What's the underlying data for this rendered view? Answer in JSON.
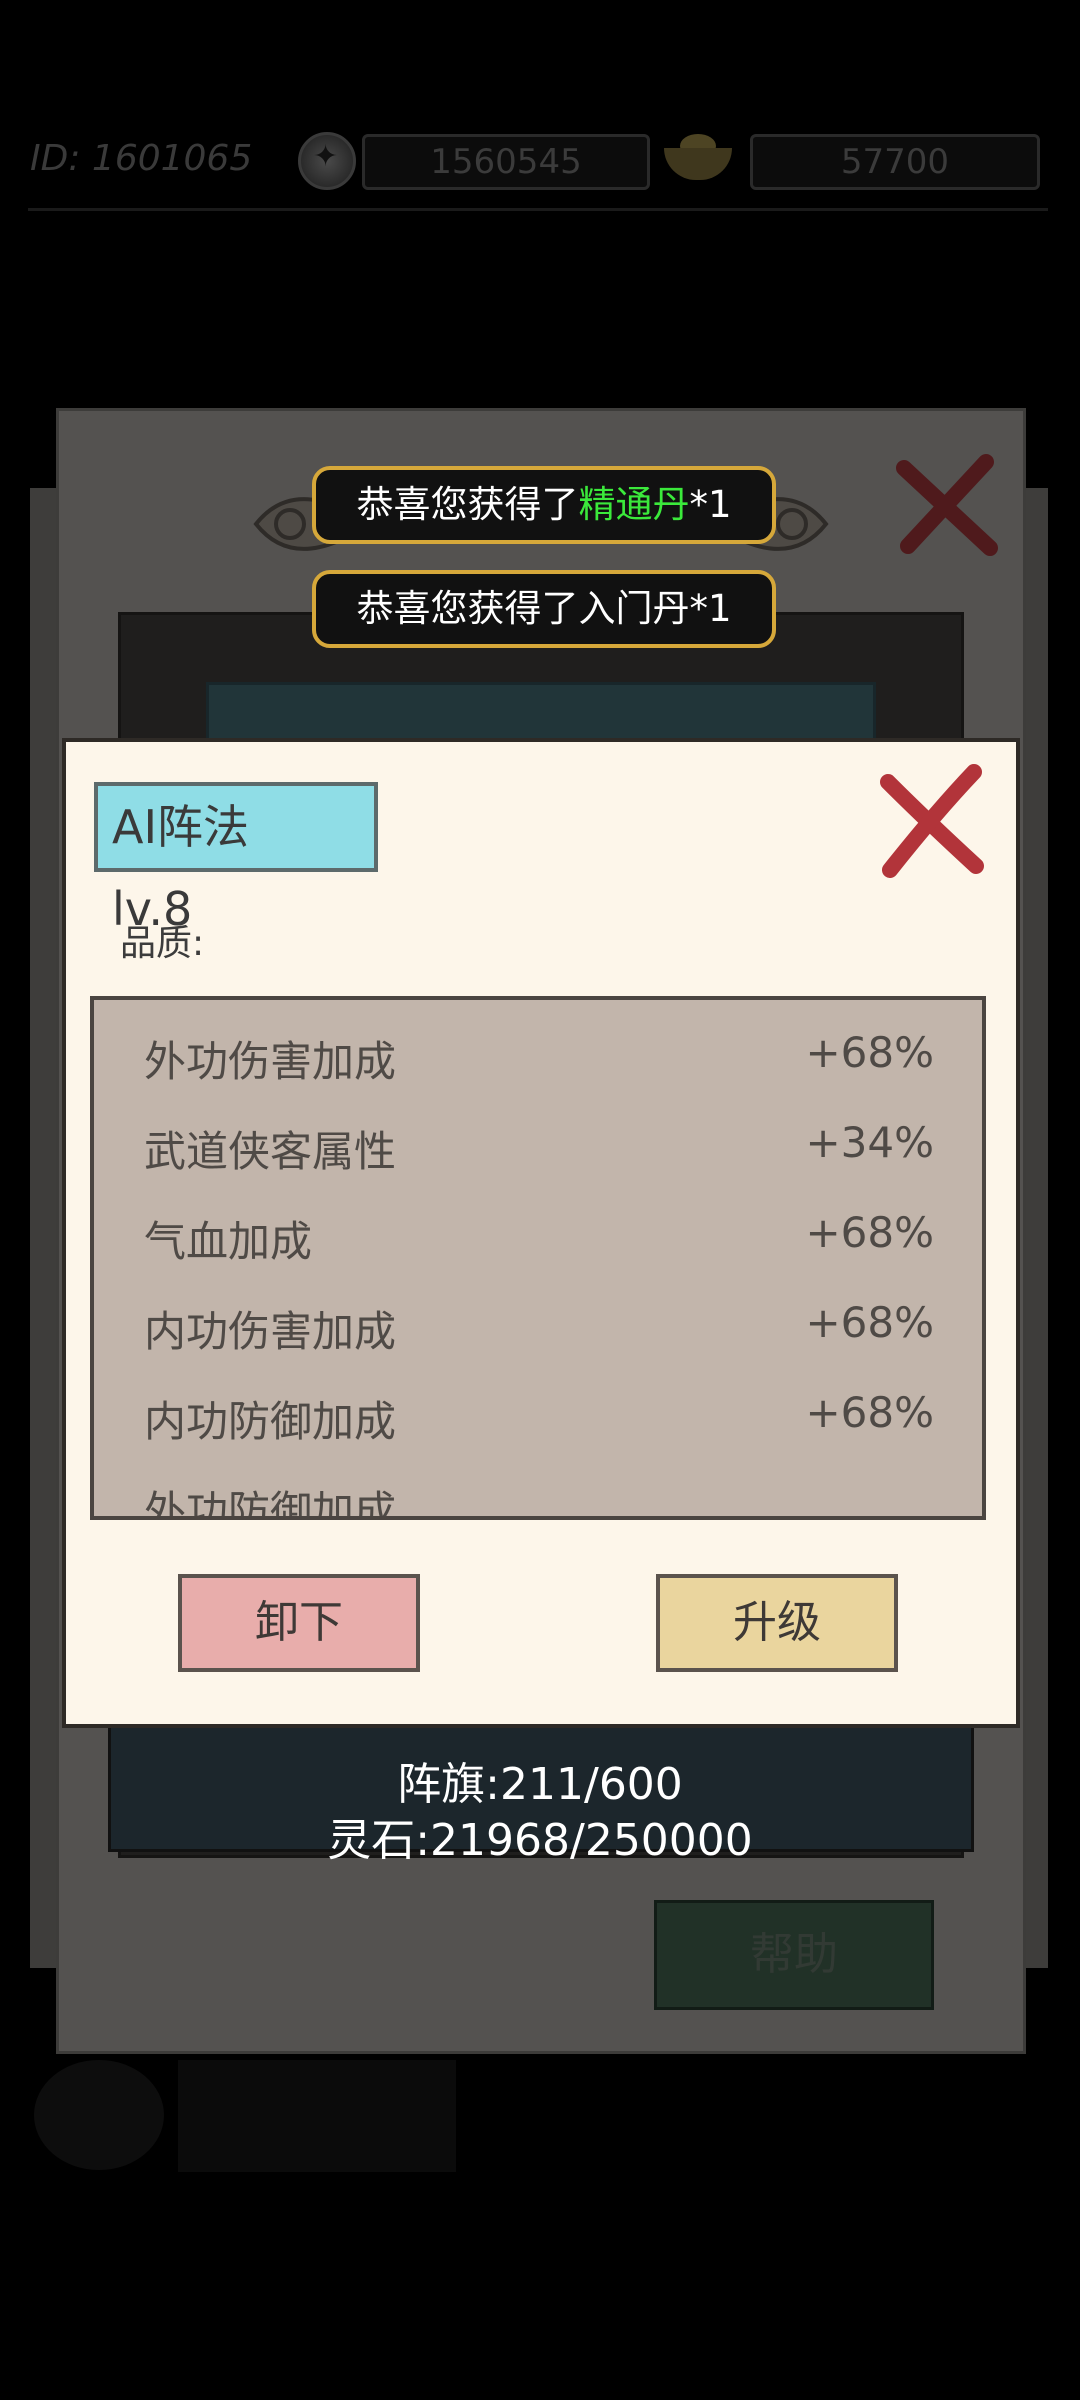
{
  "hud": {
    "player_id": "ID: 1601065",
    "coins": "1560545",
    "coin_icon": "star-coin-icon",
    "ingots": "57700",
    "ingot_icon": "gold-ingot-icon"
  },
  "toasts": [
    {
      "prefix": "恭喜您获得了",
      "item": "精通丹",
      "suffix": "*1",
      "item_color": "#3be93b"
    },
    {
      "prefix": "恭喜您获得了",
      "item": "入门丹",
      "suffix": "*1",
      "item_color": "#ffffff"
    }
  ],
  "dialog": {
    "name": "AI阵法　lv.8",
    "quality_label": "品质:",
    "stats": [
      {
        "name": "外功伤害加成",
        "value": "+68%"
      },
      {
        "name": "武道侠客属性",
        "value": "+34%"
      },
      {
        "name": "气血加成",
        "value": "+68%"
      },
      {
        "name": "内功伤害加成",
        "value": "+68%"
      },
      {
        "name": "内功防御加成",
        "value": "+68%"
      },
      {
        "name": "外功防御加成",
        "value": ""
      }
    ],
    "unequip_label": "卸下",
    "upgrade_label": "升级"
  },
  "background": {
    "flags": "阵旗:211/600",
    "spirit_stones": "灵石:21968/250000",
    "help_label": "帮助"
  },
  "colors": {
    "tag_bg": "#8fdde6",
    "unequip_bg": "#e8adab",
    "upgrade_bg": "#ead59e",
    "toast_border": "#d6a83a",
    "close_red": "#b2343a"
  }
}
